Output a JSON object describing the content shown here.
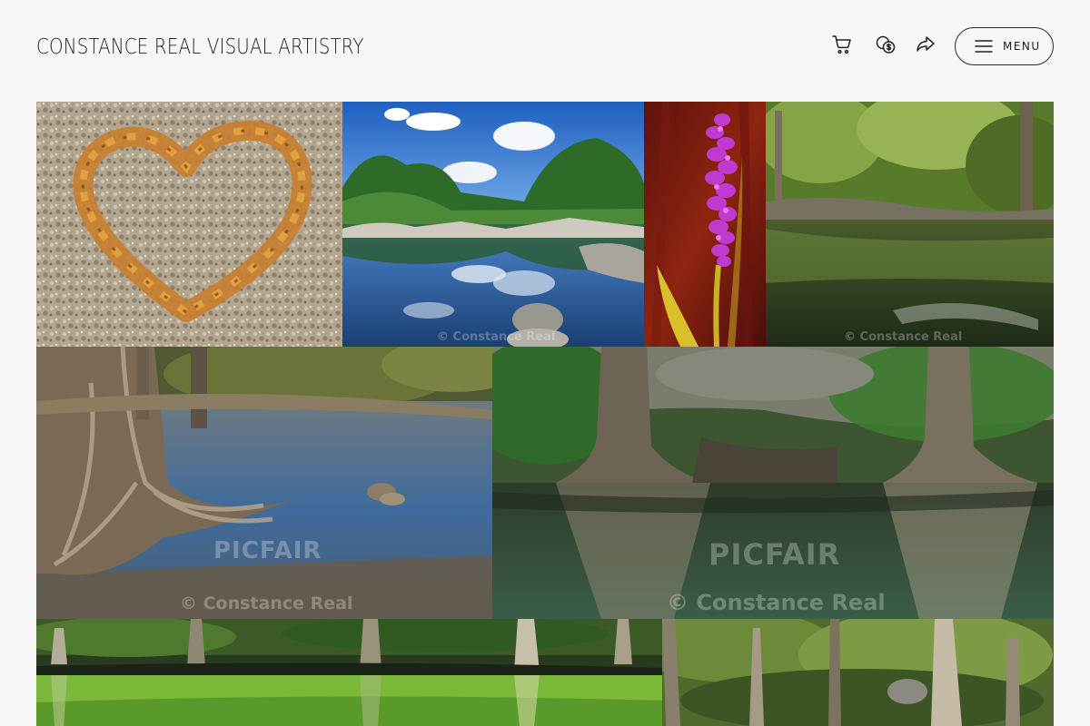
{
  "header": {
    "site_title": "CONSTANCE REAL VISUAL ARTISTRY",
    "icons": [
      "cart-icon",
      "currency-icon",
      "share-icon"
    ],
    "menu_label": "MENU"
  },
  "watermark": {
    "brand": "PICFAIR",
    "credit": "© Constance Real"
  },
  "gallery": {
    "photos": [
      {
        "subject": "leaf-heart-on-gravel"
      },
      {
        "subject": "river-cloud-reflection"
      },
      {
        "subject": "purple-flower-spike"
      },
      {
        "subject": "cypress-river-bank"
      },
      {
        "subject": "cypress-roots-stream"
      },
      {
        "subject": "cypress-trunks-reflection"
      },
      {
        "subject": "green-river-reflection"
      },
      {
        "subject": "cypress-forest"
      }
    ]
  },
  "colors": {
    "background": "#f7f7f7",
    "text": "#1f1f1f"
  }
}
